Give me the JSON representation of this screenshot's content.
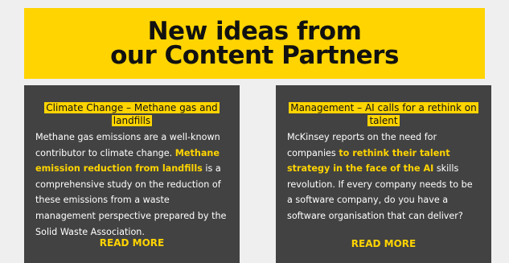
{
  "banner": {
    "title_line1": "New ideas from",
    "title_line2": "our Content Partners"
  },
  "cards": [
    {
      "heading": "Climate Change – Methane gas and landfills",
      "body_start": "Methane gas emissions are a well-known contributor to climate change. ",
      "body_highlight": "Methane emission reduction from landfills",
      "body_end": " is a comprehensive study on the reduction of these emissions from a waste management perspective prepared by the Solid Waste Association.",
      "read_more": "READ MORE"
    },
    {
      "heading": "Management – AI calls for a rethink on talent",
      "body_start": "McKinsey reports on the need for companies ",
      "body_highlight": "to rethink their talent strategy in the face of the AI",
      "body_end": " skills revolution. If every company needs to be a software company, do you have a software organisation that can deliver?",
      "read_more": "READ MORE"
    }
  ],
  "colors": {
    "accent": "#ffd400",
    "card_bg": "#424242",
    "page_bg": "#efefef"
  }
}
